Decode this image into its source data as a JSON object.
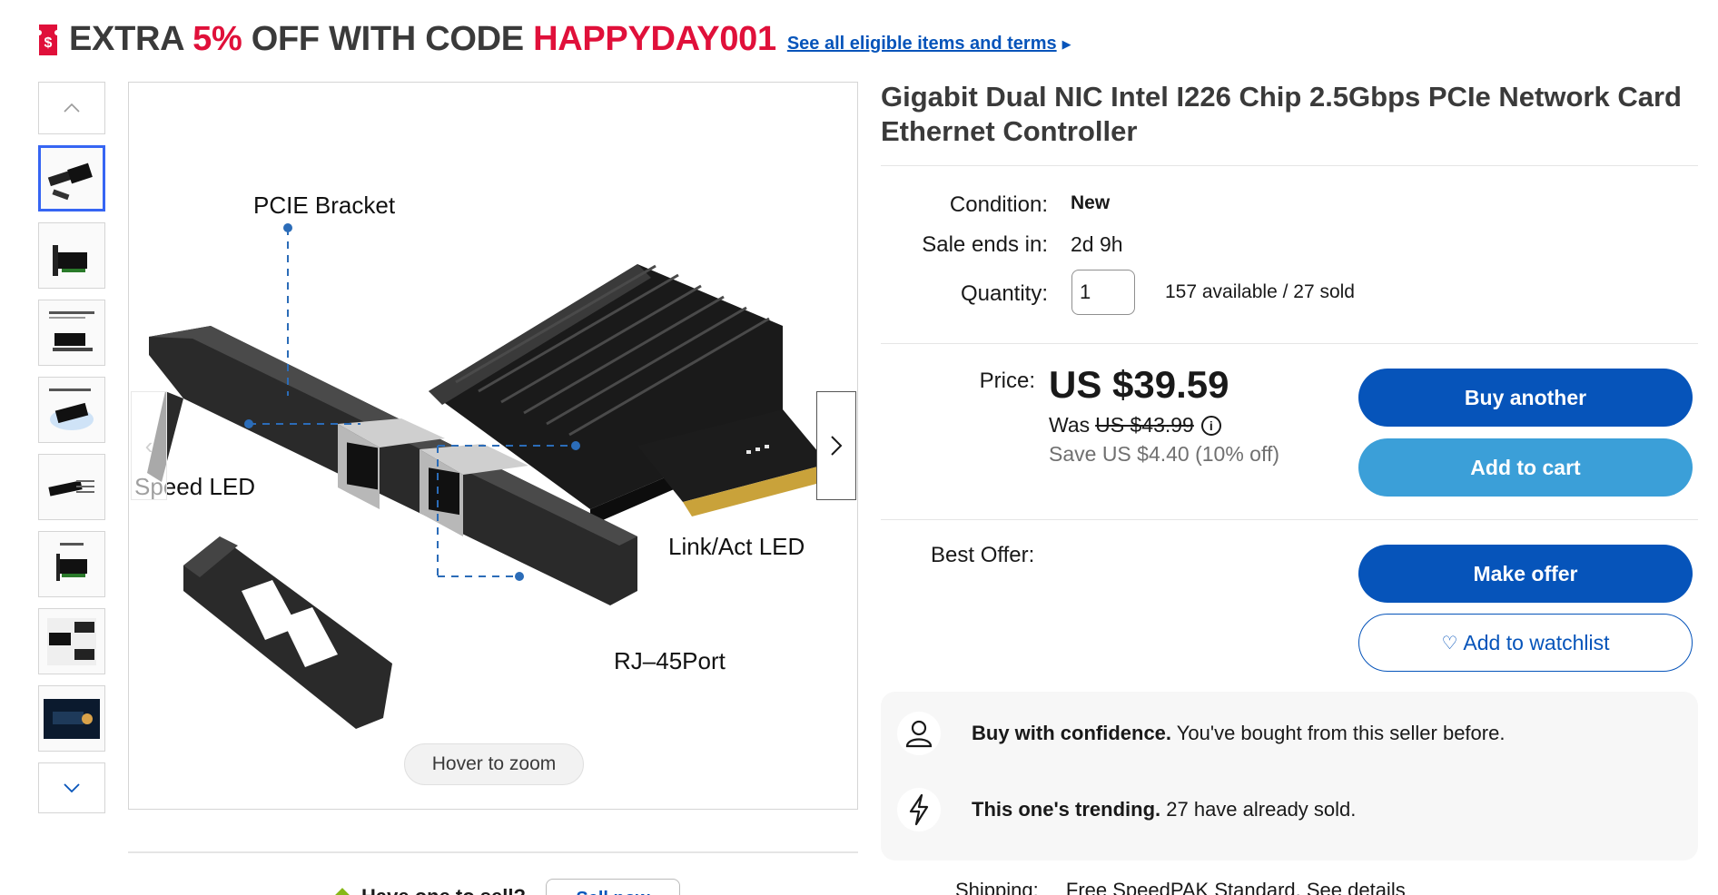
{
  "promo": {
    "prefix": "EXTRA ",
    "percent": "5%",
    "middle": " OFF WITH CODE ",
    "code": "HAPPYDAY001",
    "link": "See all eligible items and terms",
    "icon": "coupon-tag-icon"
  },
  "gallery": {
    "thumbnail_count": 8,
    "selected_index": 0,
    "zoom_hint": "Hover to zoom",
    "annotations": {
      "bracket": "PCIE Bracket",
      "speed_led": "Speed LED",
      "link_led": "Link/Act LED",
      "rj45": "RJ–45Port"
    }
  },
  "below_gallery": {
    "label": "Have one to sell?",
    "button": "Sell now"
  },
  "listing": {
    "title": "Gigabit Dual NIC Intel I226 Chip 2.5Gbps PCIe Network Card Ethernet Controller",
    "condition_label": "Condition:",
    "condition_value": "New",
    "sale_label": "Sale ends in:",
    "sale_value": "2d 9h",
    "quantity_label": "Quantity:",
    "quantity_value": "1",
    "availability": "157 available / 27 sold",
    "price_label": "Price:",
    "price": "US $39.59",
    "was_label": "Was",
    "was_price": "US $43.99",
    "save_text": "Save US $4.40 (10% off)",
    "best_offer_label": "Best Offer:"
  },
  "actions": {
    "buy": "Buy another",
    "cart": "Add to cart",
    "offer": "Make offer",
    "watch": "Add to watchlist"
  },
  "confidence": [
    {
      "icon": "person-icon",
      "bold": "Buy with confidence.",
      "text": " You've bought from this seller before."
    },
    {
      "icon": "lightning-icon",
      "bold": "This one's trending.",
      "text": " 27 have already sold."
    }
  ],
  "shipping": {
    "label": "Shipping:",
    "value": "Free SpeedPAK Standard. See details"
  },
  "colors": {
    "primary_blue": "#0654ba",
    "secondary_blue": "#3b9fd8",
    "promo_red": "#e0103a",
    "link_blue": "#0654ba"
  }
}
